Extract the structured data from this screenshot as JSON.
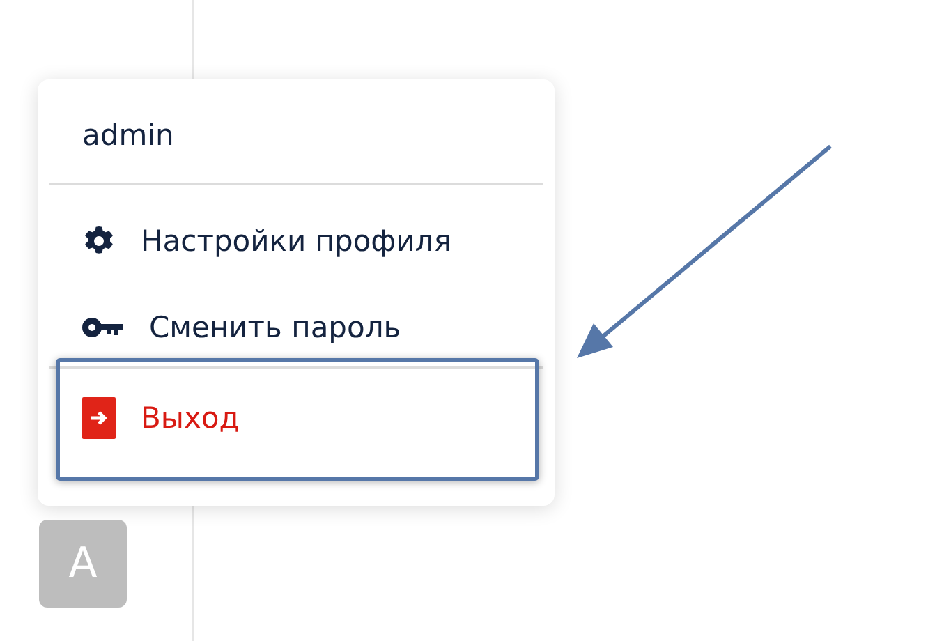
{
  "user_menu": {
    "username": "admin",
    "items": [
      {
        "kind": "settings",
        "label": "Настройки профиля",
        "highlighted": false
      },
      {
        "kind": "password",
        "label": "Сменить пароль",
        "highlighted": false
      },
      {
        "kind": "logout",
        "label": "Выход",
        "highlighted": true
      }
    ]
  },
  "avatar": {
    "initial": "A"
  }
}
